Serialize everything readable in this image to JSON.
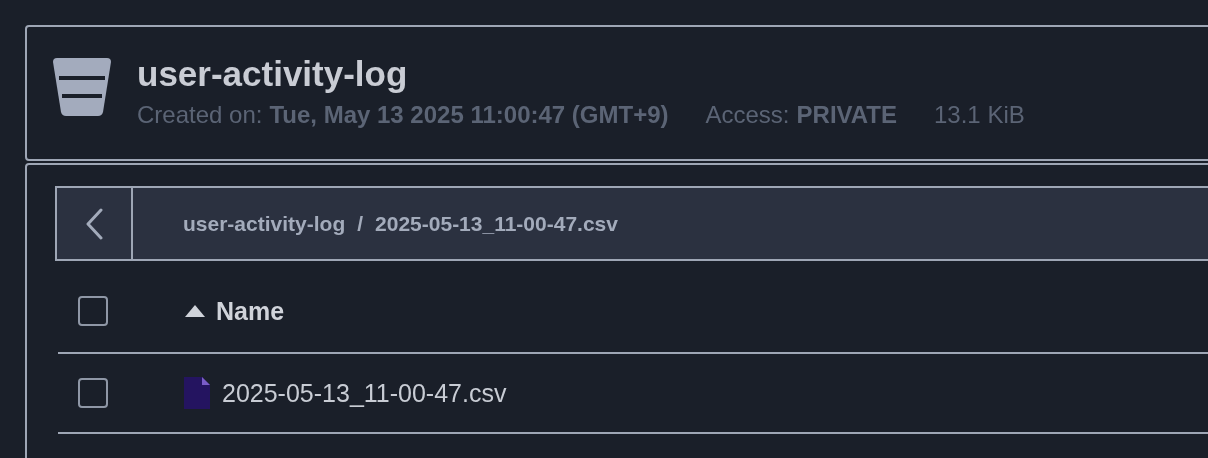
{
  "bucket": {
    "title": "user-activity-log",
    "created_label": "Created on:",
    "created_value": "Tue, May 13 2025 11:00:47 (GMT+9)",
    "access_label": "Access:",
    "access_value": "PRIVATE",
    "size": "13.1 KiB"
  },
  "breadcrumb": {
    "items": [
      "user-activity-log",
      "2025-05-13_11-00-47.csv"
    ],
    "separator": "/"
  },
  "table": {
    "select_all": {
      "checked": false
    },
    "columns": [
      {
        "label": "Name",
        "sorted_ascending": true
      }
    ],
    "rows": [
      {
        "name": "2025-05-13_11-00-47.csv",
        "kind": "file",
        "checked": false
      }
    ]
  }
}
